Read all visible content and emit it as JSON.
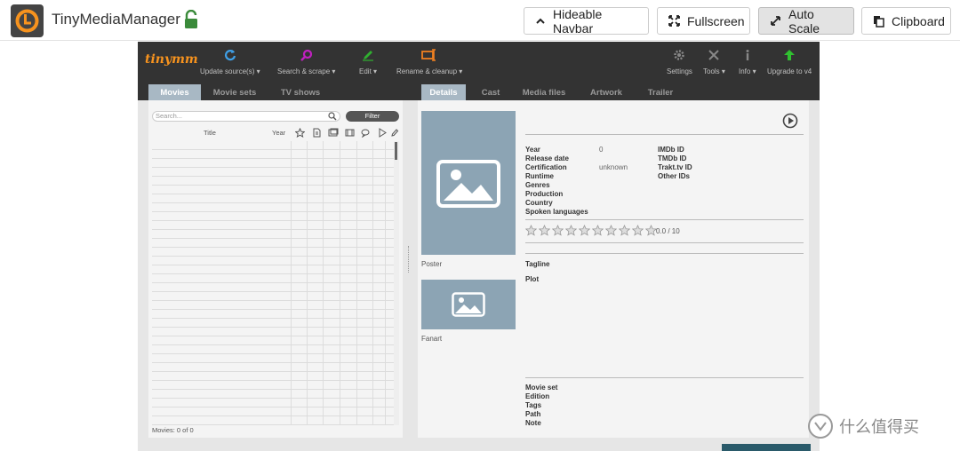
{
  "topbar": {
    "app_title": "TinyMediaManager",
    "buttons": [
      {
        "label": "Hideable Navbar",
        "icon": "chevron-up-icon",
        "active": false
      },
      {
        "label": "Fullscreen",
        "icon": "fullscreen-icon",
        "active": false
      },
      {
        "label": "Auto Scale",
        "icon": "resize-arrows-icon",
        "active": true
      },
      {
        "label": "Clipboard",
        "icon": "clipboard-icon",
        "active": false
      }
    ]
  },
  "app": {
    "logo": "tinymm",
    "toolbar": [
      {
        "label": "Update source(s)",
        "icon": "refresh-icon",
        "color": "#3fa0e8"
      },
      {
        "label": "Search & scrape",
        "icon": "magnifier-icon",
        "color": "#c020c0"
      },
      {
        "label": "Edit",
        "icon": "pencil-icon",
        "color": "#30b030"
      },
      {
        "label": "Rename & cleanup",
        "icon": "rename-icon",
        "color": "#f08020"
      },
      {
        "label": "Settings",
        "icon": "gear-icon",
        "color": "#888888"
      },
      {
        "label": "Tools",
        "icon": "tools-icon",
        "color": "#888888"
      },
      {
        "label": "Info",
        "icon": "info-icon",
        "color": "#888888"
      },
      {
        "label": "Upgrade to v4",
        "icon": "up-arrow-icon",
        "color": "#30c030"
      }
    ],
    "left_tabs": [
      "Movies",
      "Movie sets",
      "TV shows"
    ],
    "right_tabs": [
      "Details",
      "Cast",
      "Media files",
      "Artwork",
      "Trailer"
    ],
    "search_placeholder": "Search...",
    "filter_label": "Filter",
    "columns": {
      "title": "Title",
      "year": "Year"
    },
    "movie_count": "Movies:  0  of  0",
    "details": {
      "poster_label": "Poster",
      "fanart_label": "Fanart",
      "left_fields": [
        {
          "label": "Year",
          "value": "0"
        },
        {
          "label": "Release date",
          "value": ""
        },
        {
          "label": "Certification",
          "value": "unknown"
        },
        {
          "label": "Runtime",
          "value": ""
        },
        {
          "label": "Genres",
          "value": ""
        },
        {
          "label": "Production",
          "value": ""
        },
        {
          "label": "Country",
          "value": ""
        },
        {
          "label": "Spoken languages",
          "value": ""
        }
      ],
      "right_fields": [
        "IMDb ID",
        "TMDb ID",
        "Trakt.tv ID",
        "Other IDs"
      ],
      "rating": {
        "value": 0.0,
        "max": 10,
        "text": "0.0 / 10",
        "stars": 10
      },
      "tagline_label": "Tagline",
      "plot_label": "Plot",
      "bottom_fields": [
        "Movie set",
        "Edition",
        "Tags",
        "Path",
        "Note"
      ]
    }
  },
  "watermark": "什么值得买"
}
